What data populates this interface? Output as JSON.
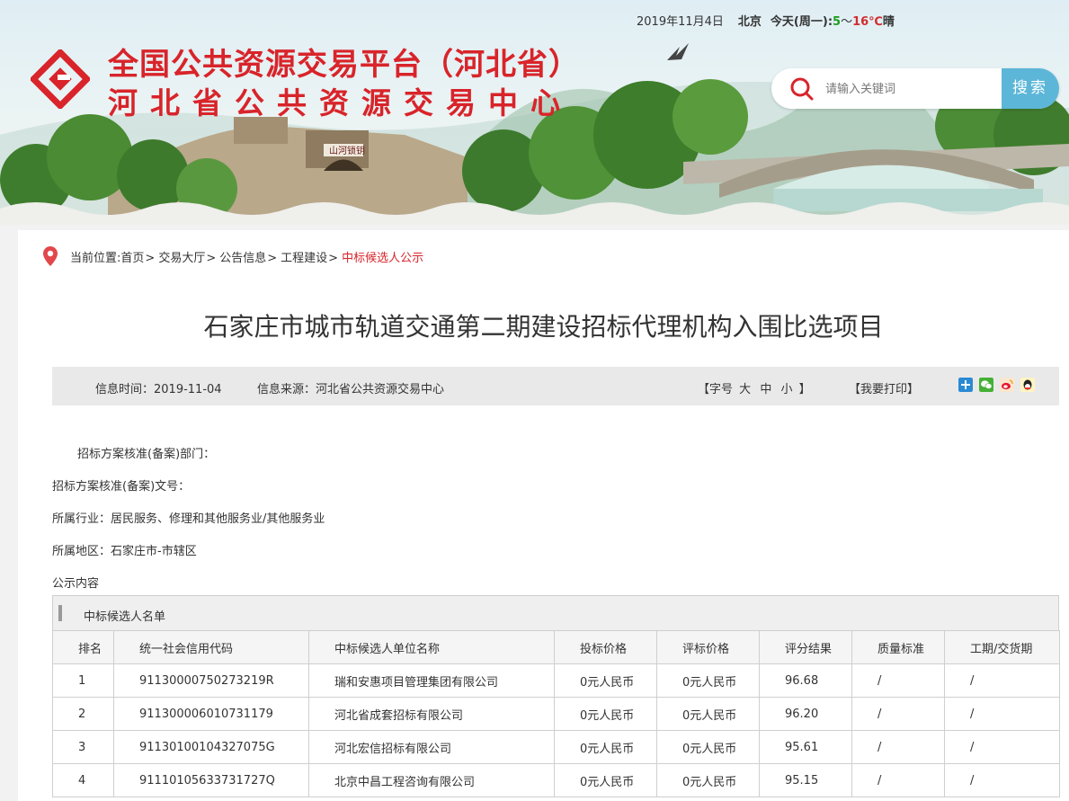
{
  "topbar": {
    "date": "2019年11月4日",
    "city": "北京",
    "today_label": "今天(周一)",
    "temp_low": "5",
    "temp_sep": "～",
    "temp_high": "16℃",
    "weather": "晴"
  },
  "header": {
    "title_line1": "全国公共资源交易平台（河北省）",
    "title_line2": "河北省公共资源交易中心",
    "search_placeholder": "请输入关键词",
    "search_button": "搜索",
    "gate_sign": "山河锁钥"
  },
  "breadcrumb": {
    "prefix": "当前位置:",
    "items": [
      "首页",
      "交易大厅",
      "公告信息",
      "工程建设"
    ],
    "separator": ">",
    "current": "中标候选人公示"
  },
  "article": {
    "title": "石家庄市城市轨道交通第二期建设招标代理机构入围比选项目",
    "info_time": "信息时间：2019-11-04",
    "info_source": "信息来源：河北省公共资源交易中心",
    "font_size_label_open": "【字号",
    "font_size_options": [
      "大",
      "中",
      "小"
    ],
    "font_size_label_close": "】",
    "print_label": "【我要打印】",
    "lines": {
      "approval_dept": "招标方案核准(备案)部门：",
      "approval_no": "招标方案核准(备案)文号：",
      "industry": "所属行业：居民服务、修理和其他服务业/其他服务业",
      "region": "所属地区：石家庄市-市辖区",
      "content_heading": "公示内容"
    }
  },
  "share_icons": [
    "plus-share-icon",
    "wechat-icon",
    "weibo-icon",
    "qq-icon"
  ],
  "table": {
    "caption": "中标候选人名单",
    "headers": [
      "排名",
      "统一社会信用代码",
      "中标候选人单位名称",
      "投标价格",
      "评标价格",
      "评分结果",
      "质量标准",
      "工期/交货期"
    ],
    "rows": [
      [
        "1",
        "91130000750273219R",
        "瑞和安惠项目管理集团有限公司",
        "0元人民币",
        "0元人民币",
        "96.68",
        "/",
        "/"
      ],
      [
        "2",
        "911300006010731179",
        "河北省成套招标有限公司",
        "0元人民币",
        "0元人民币",
        "96.20",
        "/",
        "/"
      ],
      [
        "3",
        "91130100104327075G",
        "河北宏信招标有限公司",
        "0元人民币",
        "0元人民币",
        "95.61",
        "/",
        "/"
      ],
      [
        "4",
        "91110105633731727Q",
        "北京中昌工程咨询有限公司",
        "0元人民币",
        "0元人民币",
        "95.15",
        "/",
        "/"
      ]
    ]
  },
  "colors": {
    "brand_red": "#d8242a",
    "search_blue": "#5cb6d8",
    "temp_low": "#1f9d1f",
    "temp_high": "#d12d2d"
  }
}
